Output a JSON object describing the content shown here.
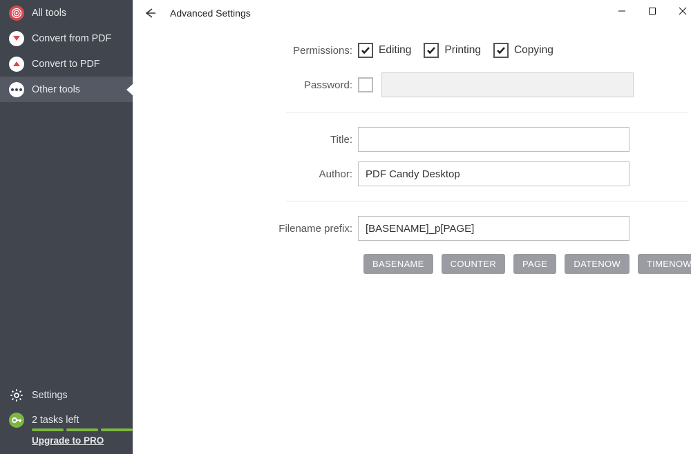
{
  "sidebar": {
    "items": [
      {
        "label": "All tools"
      },
      {
        "label": "Convert from PDF"
      },
      {
        "label": "Convert to PDF"
      },
      {
        "label": "Other tools"
      }
    ],
    "settings_label": "Settings",
    "tasks_left": "2 tasks left",
    "upgrade_label": "Upgrade to PRO"
  },
  "page": {
    "title": "Advanced Settings",
    "permissions_label": "Permissions:",
    "editing": "Editing",
    "printing": "Printing",
    "copying": "Copying",
    "password_label": "Password:",
    "password_value": "",
    "title_label": "Title:",
    "title_value": "",
    "author_label": "Author:",
    "author_value": "PDF Candy Desktop",
    "filename_prefix_label": "Filename prefix:",
    "filename_prefix_value": "[BASENAME]_p[PAGE]",
    "tokens": [
      "BASENAME",
      "COUNTER",
      "PAGE",
      "DATENOW",
      "TIMENOW"
    ]
  }
}
